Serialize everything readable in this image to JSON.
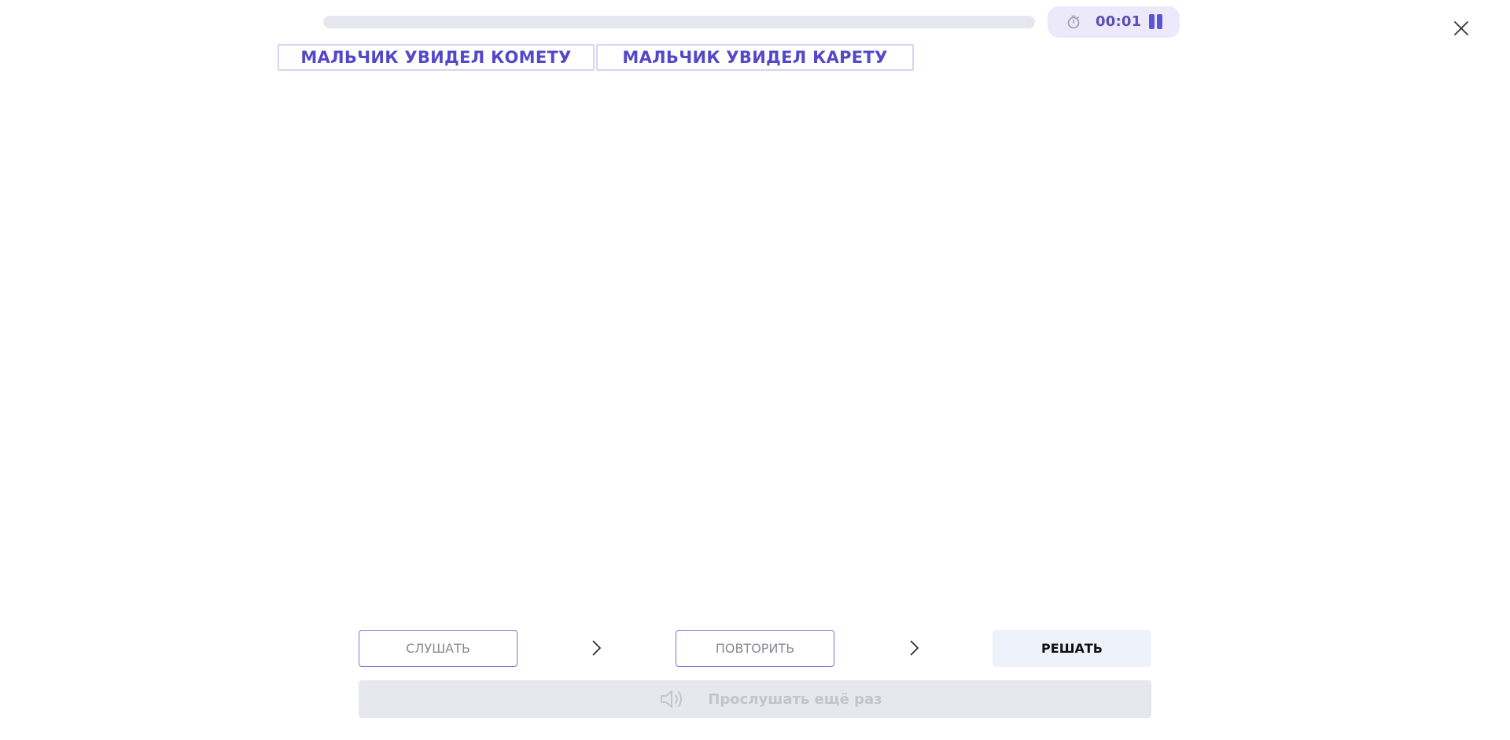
{
  "progress": {
    "fraction": 0.0
  },
  "timer": {
    "value": "00:01",
    "icon": "stopwatch-icon",
    "pause_icon": "pause-icon"
  },
  "close": {
    "icon": "close-icon"
  },
  "sentences": [
    {
      "text": "МАЛЬЧИК УВИДЕЛ КОМЕТУ"
    },
    {
      "text": "МАЛЬЧИК УВИДЕЛ КАРЕТУ"
    }
  ],
  "steps": {
    "listen_label": "СЛУШАТЬ",
    "repeat_label": "ПОВТОРИТЬ",
    "solve_label": "РЕШАТЬ",
    "separator_icon": "chevron-right-icon"
  },
  "replay": {
    "label": "Прослушать ещё раз",
    "icon": "speaker-icon"
  },
  "colors": {
    "accent": "#5548c8",
    "timer_bg": "#ece9fb",
    "progress_track": "#e6e6ef",
    "solve_bg": "#eef2fb",
    "replay_bg": "#e6e8ee"
  }
}
